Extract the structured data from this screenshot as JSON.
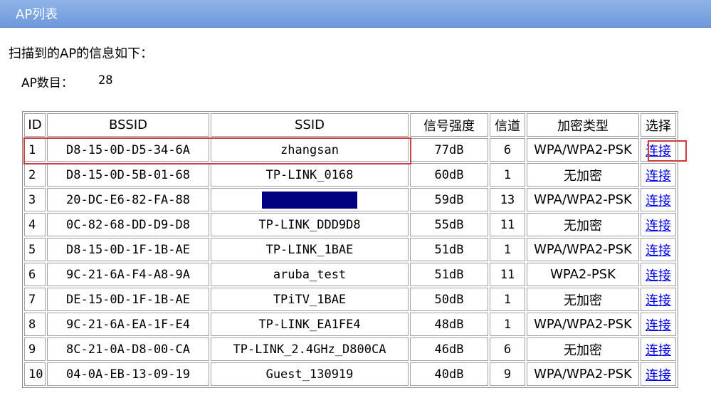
{
  "window": {
    "title": "AP列表"
  },
  "intro": "扫描到的AP的信息如下：",
  "ap_count": {
    "label": "AP数目：",
    "value": "28"
  },
  "table": {
    "headers": [
      "ID",
      "BSSID",
      "SSID",
      "信号强度",
      "信道",
      "加密类型",
      "选择"
    ],
    "rows": [
      {
        "id": "1",
        "bssid": "D8-15-0D-D5-34-6A",
        "ssid": "zhangsan",
        "signal": "77dB",
        "channel": "6",
        "encryption": "WPA/WPA2-PSK",
        "action": "连接"
      },
      {
        "id": "2",
        "bssid": "D8-15-0D-5B-01-68",
        "ssid": "TP-LINK_0168",
        "signal": "60dB",
        "channel": "1",
        "encryption": "无加密",
        "action": "连接"
      },
      {
        "id": "3",
        "bssid": "20-DC-E6-82-FA-88",
        "ssid": "",
        "signal": "59dB",
        "channel": "13",
        "encryption": "WPA/WPA2-PSK",
        "action": "连接"
      },
      {
        "id": "4",
        "bssid": "0C-82-68-DD-D9-D8",
        "ssid": "TP-LINK_DDD9D8",
        "signal": "55dB",
        "channel": "11",
        "encryption": "无加密",
        "action": "连接"
      },
      {
        "id": "5",
        "bssid": "D8-15-0D-1F-1B-AE",
        "ssid": "TP-LINK_1BAE",
        "signal": "51dB",
        "channel": "1",
        "encryption": "WPA/WPA2-PSK",
        "action": "连接"
      },
      {
        "id": "6",
        "bssid": "9C-21-6A-F4-A8-9A",
        "ssid": "aruba_test",
        "signal": "51dB",
        "channel": "11",
        "encryption": "WPA2-PSK",
        "action": "连接"
      },
      {
        "id": "7",
        "bssid": "DE-15-0D-1F-1B-AE",
        "ssid": "TPiTV_1BAE",
        "signal": "50dB",
        "channel": "1",
        "encryption": "无加密",
        "action": "连接"
      },
      {
        "id": "8",
        "bssid": "9C-21-6A-EA-1F-E4",
        "ssid": "TP-LINK_EA1FE4",
        "signal": "48dB",
        "channel": "1",
        "encryption": "WPA/WPA2-PSK",
        "action": "连接"
      },
      {
        "id": "9",
        "bssid": "8C-21-0A-D8-00-CA",
        "ssid": "TP-LINK_2.4GHz_D800CA",
        "signal": "46dB",
        "channel": "6",
        "encryption": "无加密",
        "action": "连接"
      },
      {
        "id": "10",
        "bssid": "04-0A-EB-13-09-19",
        "ssid": "Guest_130919",
        "signal": "40dB",
        "channel": "9",
        "encryption": "WPA/WPA2-PSK",
        "action": "连接"
      }
    ]
  },
  "colors": {
    "title_bar": "#7aa3e0",
    "link": "#0000ee",
    "highlight": "#d23b3b",
    "redacted": "#000080"
  }
}
